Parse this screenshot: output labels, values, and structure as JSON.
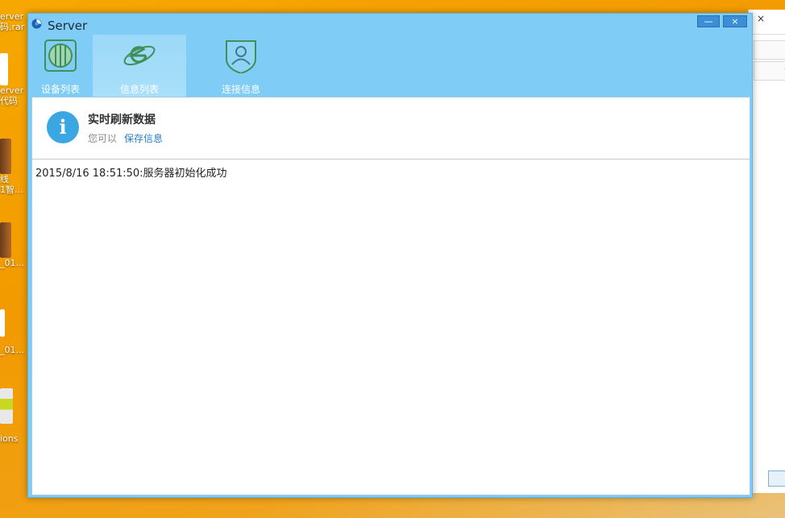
{
  "desktop": {
    "icons": [
      {
        "line1": "erver",
        "line2": "码.rar"
      },
      {
        "line1": "erver",
        "line2": "代码"
      },
      {
        "line1": "线",
        "line2": "1智..."
      },
      {
        "line1": "_01...",
        "line2": ""
      },
      {
        "line1": "_01...",
        "line2": ""
      },
      {
        "line1": "ions",
        "line2": ""
      }
    ]
  },
  "background_window": {
    "close_glyph": "×",
    "up_glyph": "^"
  },
  "window": {
    "title": "Server",
    "minimize_glyph": "—",
    "close_glyph": "×"
  },
  "toolbar": {
    "tabs": [
      {
        "label": "设备列表",
        "icon": "device-list-icon"
      },
      {
        "label": "信息列表",
        "icon": "info-list-icon"
      },
      {
        "label": "连接信息",
        "icon": "connection-info-icon"
      }
    ]
  },
  "info_panel": {
    "title": "实时刷新数据",
    "subtitle": "您可以",
    "link": "保存信息",
    "icon_glyph": "i"
  },
  "log": {
    "lines": [
      "2015/8/16 18:51:50:服务器初始化成功"
    ]
  },
  "colors": {
    "window_frame": "#7fcdf6",
    "accent": "#3aa6e2",
    "link": "#2a7fc4"
  }
}
